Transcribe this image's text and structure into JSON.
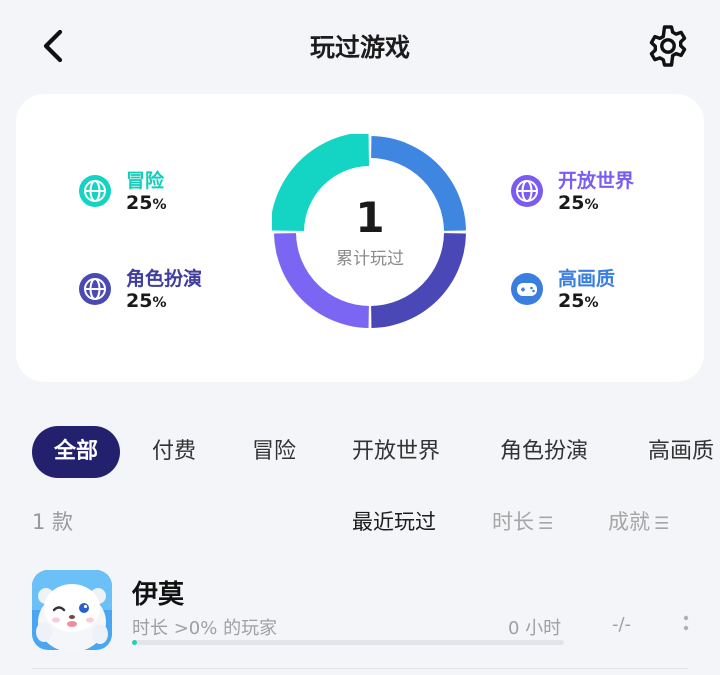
{
  "header": {
    "title": "玩过游戏",
    "back_icon": "chevron-left-icon",
    "settings_icon": "gear-icon"
  },
  "stats": {
    "total": "1",
    "total_label": "累计玩过",
    "categories": [
      {
        "label": "冒险",
        "percent": "25",
        "unit": "%",
        "color": "#14d2c4",
        "icon": "globe-icon"
      },
      {
        "label": "角色扮演",
        "percent": "25",
        "unit": "%",
        "color": "#4a4ab0",
        "icon": "globe-icon"
      },
      {
        "label": "开放世界",
        "percent": "25",
        "unit": "%",
        "color": "#7a5cf0",
        "icon": "globe-icon"
      },
      {
        "label": "高画质",
        "percent": "25",
        "unit": "%",
        "color": "#3a7ee0",
        "icon": "gamepad-icon"
      }
    ],
    "donut_segments": [
      {
        "name": "开放世界",
        "value": 25,
        "color": "#3f86e0"
      },
      {
        "name": "角色扮演",
        "value": 25,
        "color": "#4a47b6"
      },
      {
        "name": "高画质",
        "value": 25,
        "color": "#7b66f4"
      },
      {
        "name": "冒险",
        "value": 25,
        "color": "#14d5c4"
      }
    ]
  },
  "tabs": [
    "全部",
    "付费",
    "冒险",
    "开放世界",
    "角色扮演",
    "高画质"
  ],
  "list": {
    "count": "1 款",
    "sort": {
      "recent": "最近玩过",
      "duration": "时长",
      "achievement": "成就"
    },
    "games": [
      {
        "name": "伊莫",
        "subtitle": "时长 >0% 的玩家",
        "hours": "0 小时",
        "achievement": "-/-",
        "progress": 0.01
      }
    ]
  },
  "colors": {
    "accent": "#23216e",
    "background": "#f4f5f8"
  }
}
